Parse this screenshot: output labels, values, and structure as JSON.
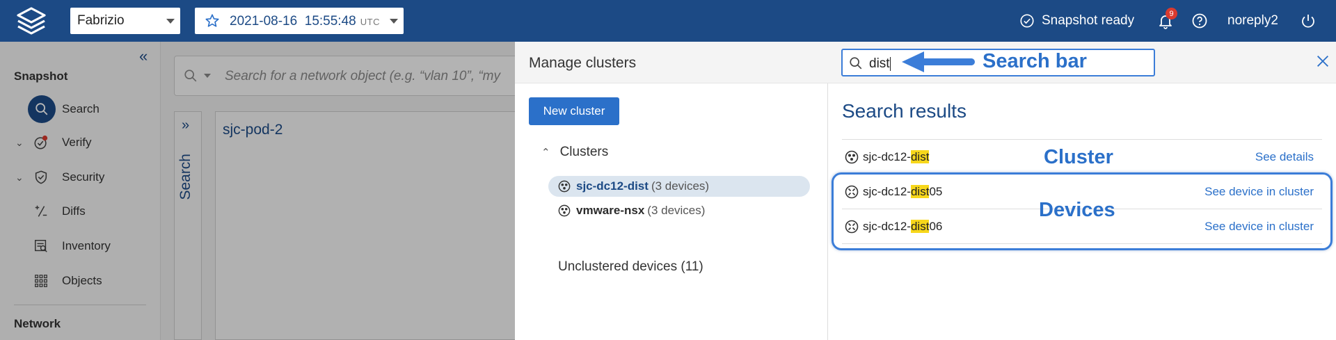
{
  "topbar": {
    "workspace": "Fabrizio",
    "snapshot_date": "2021-08-16",
    "snapshot_time": "15:55:48",
    "timezone": "UTC",
    "status": "Snapshot ready",
    "notifications": "9",
    "user": "noreply2"
  },
  "sidebar": {
    "section_snapshot": "Snapshot",
    "items": [
      {
        "label": "Search",
        "icon": "search-icon"
      },
      {
        "label": "Verify",
        "icon": "verify-icon"
      },
      {
        "label": "Security",
        "icon": "shield-icon"
      },
      {
        "label": "Diffs",
        "icon": "diff-icon"
      },
      {
        "label": "Inventory",
        "icon": "inventory-icon"
      },
      {
        "label": "Objects",
        "icon": "grid-icon"
      }
    ],
    "section_network": "Network"
  },
  "background": {
    "search_placeholder": "Search for a network object (e.g. “vlan 10”, “my",
    "vertical_tab": "Search",
    "card_title": "sjc-pod-2"
  },
  "modal": {
    "title": "Manage clusters",
    "search_value": "dist",
    "new_cluster_label": "New cluster",
    "clusters_heading": "Clusters",
    "clusters": [
      {
        "name": "sjc-dc12-dist",
        "count": "(3 devices)",
        "selected": true
      },
      {
        "name": "vmware-nsx",
        "count": "(3 devices)",
        "selected": false
      }
    ],
    "unclustered": "Unclustered devices (11)",
    "results_title": "Search results",
    "results": [
      {
        "prefix": "sjc-dc12-",
        "match": "dist",
        "suffix": "",
        "link": "See details",
        "icon": "cluster-icon"
      },
      {
        "prefix": "sjc-dc12-",
        "match": "dist",
        "suffix": "05",
        "link": "See device in cluster",
        "icon": "device-icon"
      },
      {
        "prefix": "sjc-dc12-",
        "match": "dist",
        "suffix": "06",
        "link": "See device in cluster",
        "icon": "device-icon"
      }
    ]
  },
  "annotations": {
    "search_bar": "Search bar",
    "cluster": "Cluster",
    "devices": "Devices"
  },
  "colors": {
    "brand": "#1c4a85",
    "accent": "#2b70c9",
    "highlight": "#f7d71b"
  }
}
